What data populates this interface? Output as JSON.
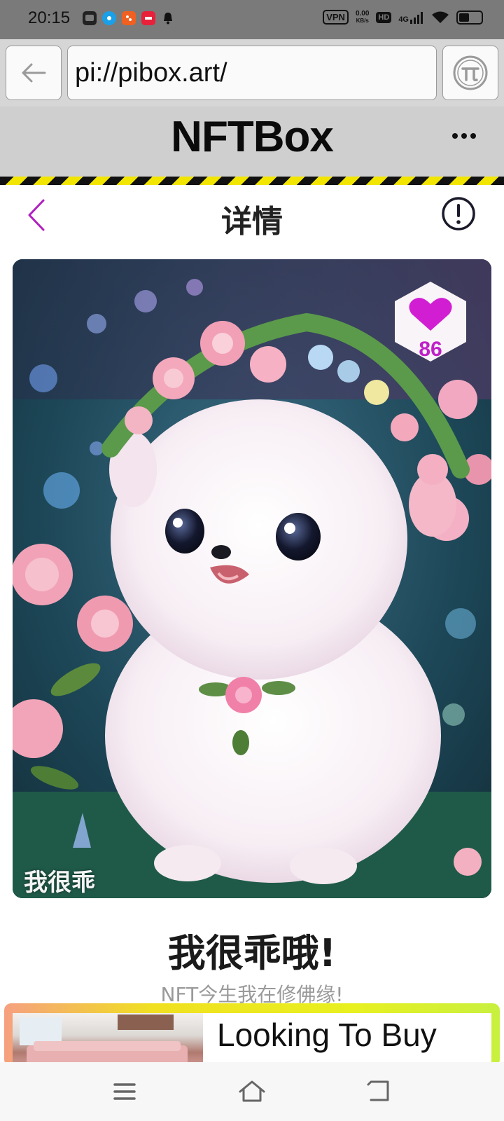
{
  "status_bar": {
    "time": "20:15",
    "vpn": "VPN",
    "speed_value": "0.00",
    "speed_unit": "KB/s",
    "hd": "HD",
    "network": "4G",
    "icons": [
      "chat-icon",
      "app-icon-blue",
      "app-icon-orange",
      "app-icon-red",
      "bell-icon"
    ]
  },
  "browser": {
    "url": "pi://pibox.art/"
  },
  "app": {
    "title": "NFTBox"
  },
  "detail": {
    "title": "详情",
    "like_count": "86",
    "image_caption": "我很乖",
    "nft_title": "我很乖哦!",
    "nft_subtitle": "NFT今生我在修佛缘!"
  },
  "promo": {
    "text": "Looking To Buy"
  },
  "colors": {
    "accent": "#c020c8",
    "hazard_yellow": "#f2e600",
    "status_bar_bg": "#7a7a7a"
  }
}
